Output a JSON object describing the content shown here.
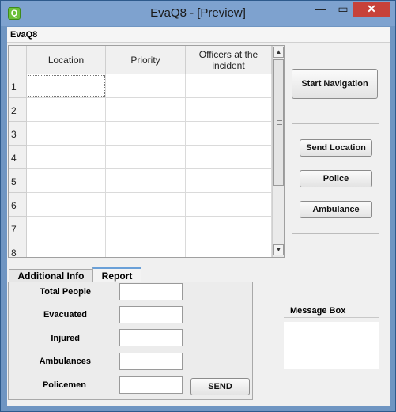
{
  "window": {
    "title": "EvaQ8 - [Preview]",
    "min_glyph": "—",
    "max_glyph": "▭",
    "close_glyph": "✕",
    "app_icon_glyph": "Q"
  },
  "menubar": {
    "label": "EvaQ8"
  },
  "table": {
    "columns": [
      "Location",
      "Priority",
      "Officers at the incident"
    ],
    "rows": [
      "1",
      "2",
      "3",
      "4",
      "5",
      "6",
      "7",
      "8"
    ]
  },
  "buttons": {
    "start_navigation": "Start Navigation",
    "send_location": "Send Location",
    "police": "Police",
    "ambulance": "Ambulance",
    "send": "SEND"
  },
  "tabs": [
    {
      "label": "Additional Info"
    },
    {
      "label": "Report"
    }
  ],
  "report": {
    "fields": [
      {
        "label": "Total People",
        "value": ""
      },
      {
        "label": "Evacuated",
        "value": ""
      },
      {
        "label": "Injured",
        "value": ""
      },
      {
        "label": "Ambulances",
        "value": ""
      },
      {
        "label": "Policemen",
        "value": ""
      }
    ]
  },
  "message_box": {
    "title": "Message Box"
  },
  "icons": {
    "scroll_up": "▲",
    "scroll_down": "▼"
  }
}
